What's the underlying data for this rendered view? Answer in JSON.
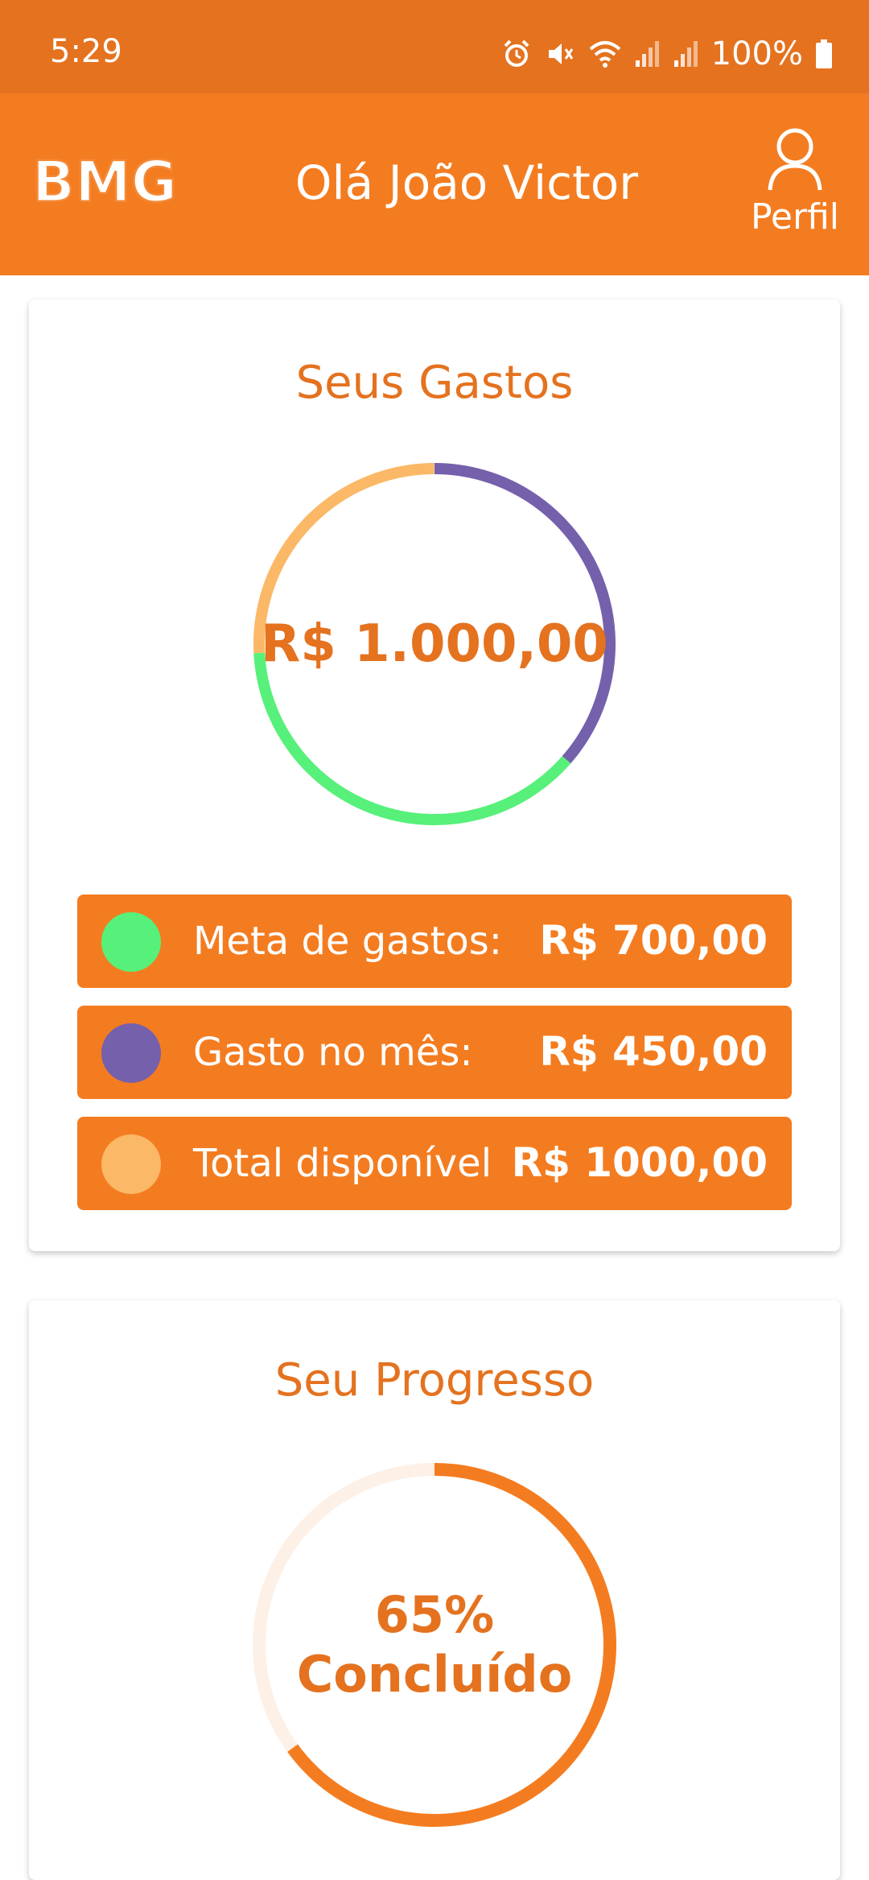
{
  "status_bar": {
    "time": "5:29",
    "battery_percent": "100%",
    "icons": [
      "alarm-icon",
      "mute-icon",
      "wifi-icon",
      "signal-icon",
      "signal-icon",
      "battery-icon"
    ]
  },
  "header": {
    "logo_text": "BMG",
    "greeting": "Olá João Victor",
    "profile_label": "Perfil",
    "profile_icon": "user-icon"
  },
  "colors": {
    "primary_orange": "#F47C20",
    "status_orange": "#E4721F",
    "green": "#57F07A",
    "purple": "#7560AC",
    "light_orange": "#FBB866",
    "progress_track": "#FDF0E6"
  },
  "spending_card": {
    "title": "Seus Gastos",
    "center_value": "R$ 1.000,00",
    "legend": [
      {
        "label": "Meta de gastos:",
        "value": "R$ 700,00",
        "color": "#57F07A"
      },
      {
        "label": "Gasto no mês:",
        "value": "R$ 450,00",
        "color": "#7560AC"
      },
      {
        "label": "Total disponível",
        "value": "R$ 1000,00",
        "color": "#FBB866"
      }
    ]
  },
  "progress_card": {
    "title": "Seu Progresso",
    "percent_label": "65%",
    "status_label": "Concluído",
    "progress_fraction": 0.65
  }
}
